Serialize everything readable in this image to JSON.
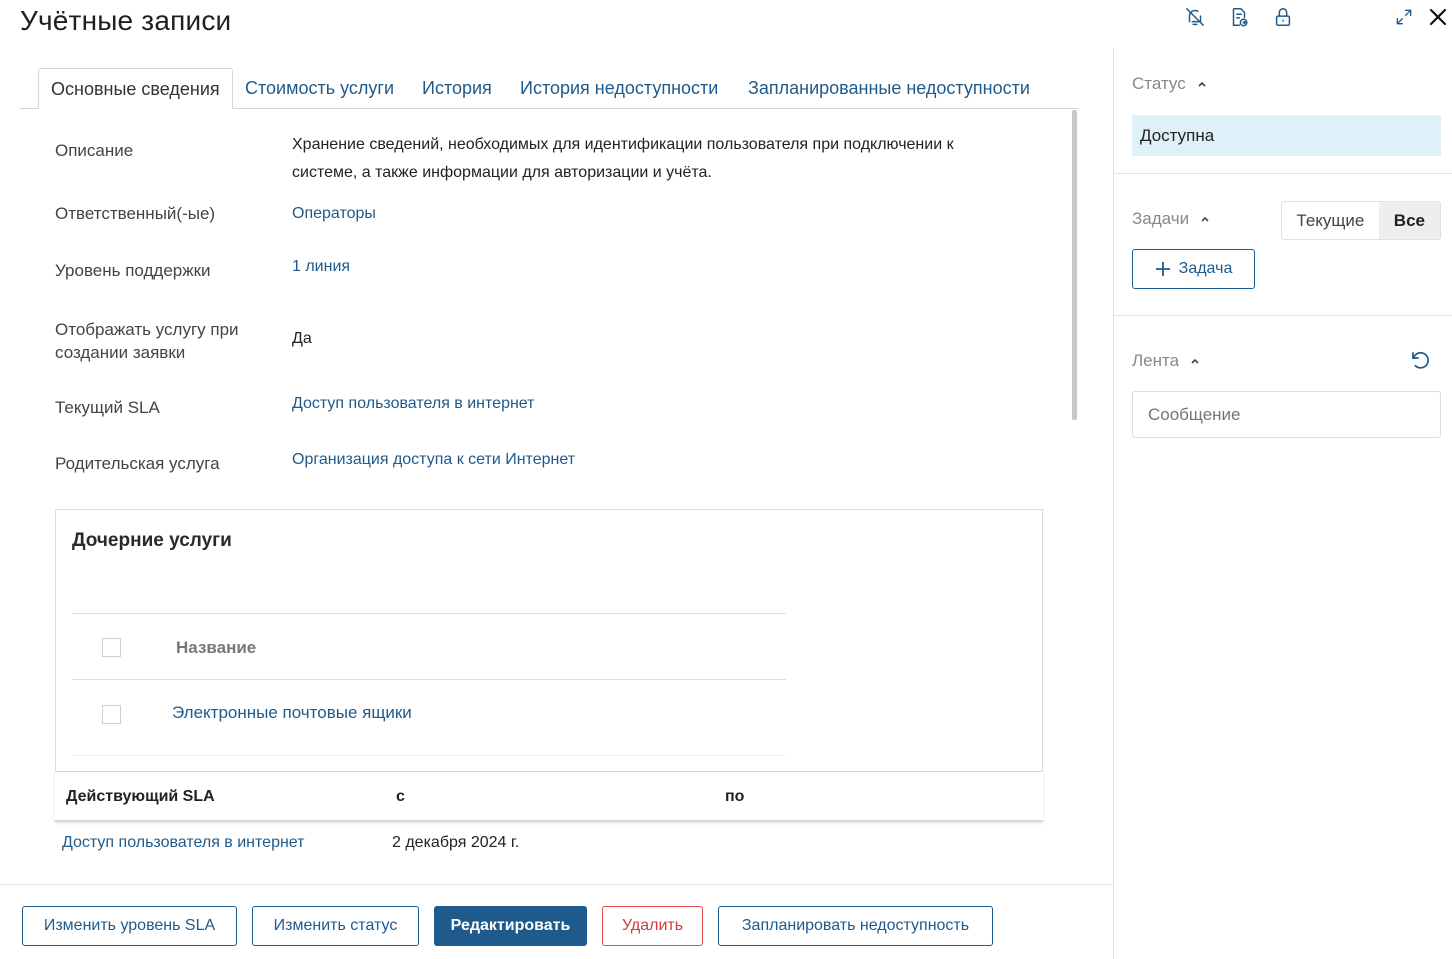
{
  "title": "Учётные записи",
  "tabs": [
    {
      "label": "Основные сведения",
      "active": true
    },
    {
      "label": "Стоимость услуги"
    },
    {
      "label": "История"
    },
    {
      "label": "История недоступности"
    },
    {
      "label": "Запланированные недоступности"
    }
  ],
  "fields": {
    "description_label": "Описание",
    "description_line1": "Хранение сведений, необходимых для идентификации пользователя при подключении к",
    "description_line2": "системе, а также информации для авторизации и учёта.",
    "responsible_label": "Ответственный(-ые)",
    "responsible_value": "Операторы",
    "support_label": "Уровень поддержки",
    "support_value": "1 линия",
    "show_label_line1": "Отображать услугу при",
    "show_label_line2": "создании заявки",
    "show_value": "Да",
    "sla_label": "Текущий SLA",
    "sla_value": "Доступ пользователя в интернет",
    "parent_label": "Родительская услуга",
    "parent_value": "Организация доступа к сети Интернет"
  },
  "child_services": {
    "title": "Дочерние услуги",
    "column_name": "Название",
    "rows": [
      "Электронные почтовые ящики"
    ]
  },
  "sla_table": {
    "col_sla": "Действующий SLA",
    "col_from": "с",
    "col_to": "по",
    "rows": [
      {
        "sla": "Доступ пользователя в интернет",
        "from": "2 декабря 2024 г.",
        "to": ""
      }
    ]
  },
  "buttons": {
    "change_sla": "Изменить уровень SLA",
    "change_status": "Изменить статус",
    "edit": "Редактировать",
    "delete": "Удалить",
    "schedule": "Запланировать недоступность"
  },
  "sidebar": {
    "status_title": "Статус",
    "status_value": "Доступна",
    "tasks_title": "Задачи",
    "seg_current": "Текущие",
    "seg_all": "Все",
    "task_button": "Задача",
    "feed_title": "Лента",
    "message_placeholder": "Сообщение"
  },
  "colors": {
    "accent": "#1f5a8c",
    "status_bg": "#dff0f8",
    "danger": "#d43b3b"
  },
  "icons": [
    "bell-off-icon",
    "document-share-icon",
    "lock-icon",
    "expand-icon",
    "close-icon",
    "chevron-up-icon",
    "plus-icon",
    "refresh-icon"
  ]
}
